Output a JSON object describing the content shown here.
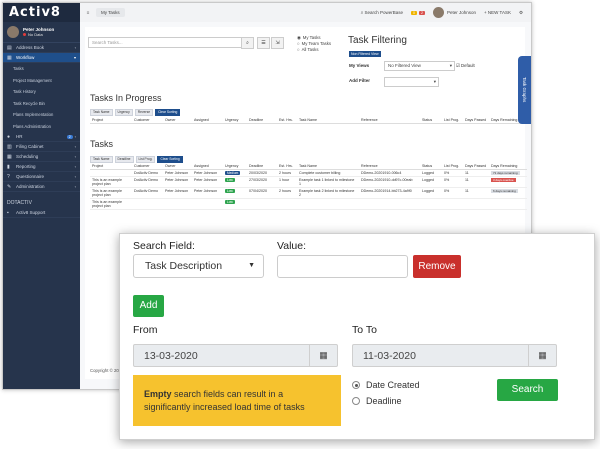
{
  "app": {
    "logo": "Activ8",
    "user": {
      "name": "Peter Johnson",
      "status": "No Data"
    },
    "sidebar": {
      "items": [
        {
          "icon": "book-icon",
          "glyph": "▤",
          "label": "Address Book",
          "active": false
        },
        {
          "icon": "grid-icon",
          "glyph": "▦",
          "label": "Workflow",
          "active": true
        }
      ],
      "workflow_sub": [
        "Tasks",
        "Project Management",
        "Task History",
        "Task Recycle Bin",
        "Plans Implementation",
        "Plans Administration"
      ],
      "items2": [
        {
          "icon": "users-icon",
          "glyph": "●",
          "label": "HR",
          "badge": "2"
        },
        {
          "icon": "cabinet-icon",
          "glyph": "▥",
          "label": "Filing Cabinet"
        },
        {
          "icon": "calendar-icon",
          "glyph": "▦",
          "label": "Scheduling"
        },
        {
          "icon": "chart-icon",
          "glyph": "▮",
          "label": "Reporting"
        },
        {
          "icon": "question-icon",
          "glyph": "?",
          "label": "Questionnaire"
        },
        {
          "icon": "wrench-icon",
          "glyph": "✎",
          "label": "Administration"
        }
      ],
      "section": "DOTACTIV",
      "support": "Activ8 Support"
    },
    "topbar": {
      "crumb": "My Tasks",
      "search": "Search PowerBase",
      "badge_yellow": "0",
      "badge_red": "2",
      "user": "Peter Johnson",
      "new_task": "+ NEW TASK"
    },
    "tasks_search_placeholder": "Search Tasks...",
    "view_radios": [
      "My Tasks",
      "My Team Tasks",
      "All Tasks"
    ],
    "task_filtering": {
      "title": "Task Filtering",
      "badge": "Non Filtered View",
      "my_views_label": "My Views",
      "my_views_value": "No Filtered View",
      "default_label": "Default",
      "add_filter_label": "Add Filter"
    },
    "graphs_tab": "Task Graphs",
    "in_progress": {
      "title": "Tasks In Progress",
      "chips": [
        "Task Name",
        "Urgency",
        "Reverse",
        "Clear Sorting"
      ],
      "columns": [
        "Project",
        "Customer",
        "Owner",
        "Assigned",
        "Urgency",
        "Deadline",
        "Est. Hrs.",
        "Task Name",
        "Reference",
        "Status",
        "List Prog.",
        "Days Passed",
        "Days Remaining"
      ]
    },
    "tasks": {
      "title": "Tasks",
      "chips": [
        "Task Name",
        "Deadline",
        "List Prog.",
        "Clear Sorting"
      ],
      "columns": [
        "Project",
        "Customer",
        "Owner",
        "Assigned",
        "Urgency",
        "Deadline",
        "Est. Hrs.",
        "Task Name",
        "Reference",
        "Status",
        "List Prog.",
        "Days Passed",
        "Days Remaining"
      ],
      "rows": [
        {
          "project": "",
          "customer": "DotActiv Demo",
          "owner": "Peter Johnson",
          "assigned": "Peter Johnson",
          "urgency": "Medium",
          "deadline": "20/03/2020",
          "hrs": "2 hours",
          "name": "Complete customer billing",
          "ref": "DDemo-20201910-006c4",
          "status": "Logged",
          "prog": "0%",
          "passed": "11",
          "remaining": "71 days remaining",
          "rem_color": "gray"
        },
        {
          "project": "This is an example project plan",
          "customer": "DotActiv Demo",
          "owner": "Peter Johnson",
          "assigned": "Peter Johnson",
          "urgency": "Low",
          "deadline": "27/03/2020",
          "hrs": "1 hour",
          "name": "Example task 1 linked to milestone 1",
          "ref": "DDemo-20201910-dd97c-00eab",
          "status": "Logged",
          "prog": "0%",
          "passed": "11",
          "remaining": "3 days overdue",
          "rem_color": "red"
        },
        {
          "project": "This is an example project plan",
          "customer": "DotActiv Demo",
          "owner": "Peter Johnson",
          "assigned": "Peter Johnson",
          "urgency": "Low",
          "deadline": "07/04/2020",
          "hrs": "2 hours",
          "name": "Example task 2 linked to milestone 2",
          "ref": "DDemo-20201914-bb273-4a9f0",
          "status": "Logged",
          "prog": "0%",
          "passed": "11",
          "remaining": "6 days remaining",
          "rem_color": "gray"
        },
        {
          "project": "This is an example project plan",
          "customer": "",
          "owner": "",
          "assigned": "",
          "urgency": "Low",
          "deadline": "",
          "hrs": "",
          "name": "",
          "ref": "",
          "status": "",
          "prog": "",
          "passed": "",
          "remaining": "",
          "rem_color": "red"
        }
      ]
    },
    "footer": "Copyright © 20"
  },
  "popup": {
    "search_field_label": "Search Field:",
    "search_field_value": "Task Description",
    "value_label": "Value:",
    "value_input": "",
    "remove_label": "Remove",
    "add_label": "Add",
    "from_label": "From",
    "from_value": "13-03-2020",
    "to_label": "To To",
    "to_value": "11-03-2020",
    "warning_bold": "Empty",
    "warning_text": " search fields can result in a significantly increased load time of tasks",
    "radio_options": [
      "Date Created",
      "Deadline"
    ],
    "radio_selected": "Date Created",
    "search_label": "Search"
  },
  "colors": {
    "sidebar": "#26344c",
    "accent_blue": "#1e4e8c",
    "remove_red": "#c9302c",
    "green": "#27a744",
    "warning_yellow": "#f6c22e"
  }
}
